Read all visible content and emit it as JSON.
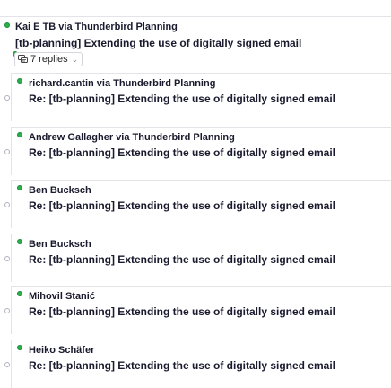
{
  "thread": {
    "root": {
      "author": "Kai E TB via Thunderbird Planning",
      "subject": "[tb-planning] Extending the use of digitally signed email",
      "replies_label": "7 replies"
    },
    "replies": [
      {
        "author": "richard.cantin via Thunderbird Planning",
        "subject": "Re: [tb-planning] Extending the use of digitally signed email"
      },
      {
        "author": "Andrew Gallagher via Thunderbird Planning",
        "subject": "Re: [tb-planning] Extending the use of digitally signed email"
      },
      {
        "author": "Ben Bucksch",
        "subject": "Re: [tb-planning] Extending the use of digitally signed email"
      },
      {
        "author": "Ben Bucksch",
        "subject": "Re: [tb-planning] Extending the use of digitally signed email"
      },
      {
        "author": "Mihovil Stanić",
        "subject": "Re: [tb-planning] Extending the use of digitally signed email"
      },
      {
        "author": "Heiko Schäfer",
        "subject": "Re: [tb-planning] Extending the use of digitally signed email"
      }
    ]
  },
  "colors": {
    "unread_dot": "#27b24a",
    "text": "#1a1a2e",
    "border": "#e3e3e8"
  },
  "icons": {
    "replies": "speech-bubbles-icon",
    "expand": "chevron-down-icon",
    "status": "unread-dot-icon"
  }
}
